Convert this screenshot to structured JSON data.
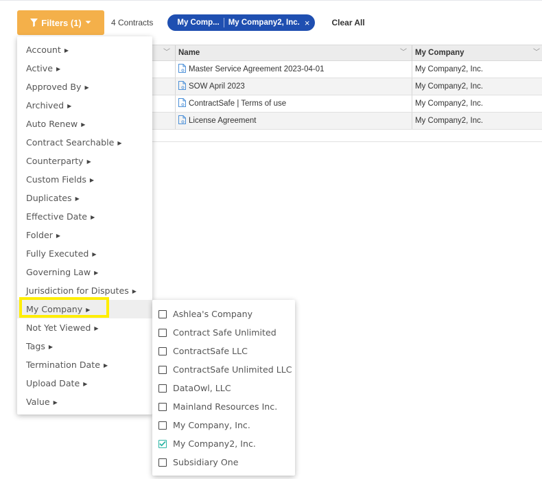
{
  "toolbar": {
    "filters_label": "Filters (1)",
    "count_label": "4 Contracts",
    "chip_part1": "My Comp...",
    "chip_part2": "My Company2, Inc.",
    "chip_close": "×",
    "clear_all": "Clear All"
  },
  "table": {
    "columns": [
      "Name",
      "My Company"
    ],
    "rows": [
      {
        "name": "Master Service Agreement 2023-04-01",
        "company": "My Company2, Inc."
      },
      {
        "name": "SOW April 2023",
        "company": "My Company2, Inc."
      },
      {
        "name": "ContractSafe | Terms of use",
        "company": "My Company2, Inc."
      },
      {
        "name": "License Agreement",
        "company": "My Company2, Inc."
      }
    ]
  },
  "filter_menu": {
    "items": [
      "Account",
      "Active",
      "Approved By",
      "Archived",
      "Auto Renew",
      "Contract Searchable",
      "Counterparty",
      "Custom Fields",
      "Duplicates",
      "Effective Date",
      "Folder",
      "Fully Executed",
      "Governing Law",
      "Jurisdiction for Disputes",
      "My Company",
      "Not Yet Viewed",
      "Tags",
      "Termination Date",
      "Upload Date",
      "Value"
    ],
    "active_item": "My Company",
    "caret_glyph": "▶"
  },
  "submenu": {
    "options": [
      {
        "label": "Ashlea's Company",
        "checked": false
      },
      {
        "label": "Contract Safe Unlimited",
        "checked": false
      },
      {
        "label": "ContractSafe LLC",
        "checked": false
      },
      {
        "label": "ContractSafe Unlimited LLC",
        "checked": false
      },
      {
        "label": "DataOwl, LLC",
        "checked": false
      },
      {
        "label": "Mainland Resources Inc.",
        "checked": false
      },
      {
        "label": "My Company, Inc.",
        "checked": false
      },
      {
        "label": "My Company2, Inc.",
        "checked": true
      },
      {
        "label": "Subsidiary One",
        "checked": false
      }
    ]
  },
  "colors": {
    "filters_button": "#f4b04a",
    "chip": "#1f4fb1",
    "highlight": "#ffee00",
    "check": "#2bb5a4",
    "doc_icon": "#4a8fd8"
  },
  "icons": {
    "filter": "funnel-icon",
    "dropdown": "chevron-down-icon",
    "document": "document-icon",
    "submenu_caret": "caret-right-icon",
    "checkbox": "checkbox-icon"
  }
}
